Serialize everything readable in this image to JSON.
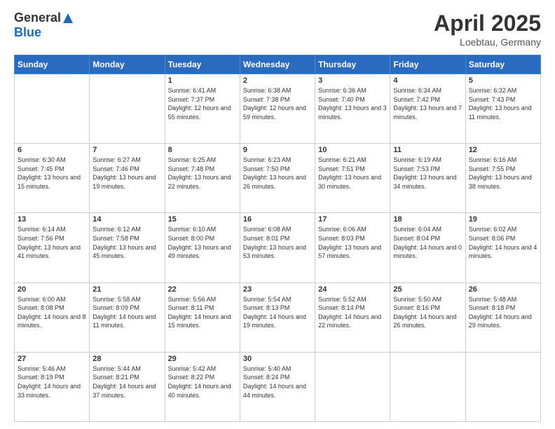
{
  "logo": {
    "general": "General",
    "blue": "Blue"
  },
  "title": "April 2025",
  "location": "Loebtau, Germany",
  "days_of_week": [
    "Sunday",
    "Monday",
    "Tuesday",
    "Wednesday",
    "Thursday",
    "Friday",
    "Saturday"
  ],
  "weeks": [
    [
      {
        "day": "",
        "sunrise": "",
        "sunset": "",
        "daylight": ""
      },
      {
        "day": "",
        "sunrise": "",
        "sunset": "",
        "daylight": ""
      },
      {
        "day": "1",
        "sunrise": "Sunrise: 6:41 AM",
        "sunset": "Sunset: 7:37 PM",
        "daylight": "Daylight: 12 hours and 55 minutes."
      },
      {
        "day": "2",
        "sunrise": "Sunrise: 6:38 AM",
        "sunset": "Sunset: 7:38 PM",
        "daylight": "Daylight: 12 hours and 59 minutes."
      },
      {
        "day": "3",
        "sunrise": "Sunrise: 6:36 AM",
        "sunset": "Sunset: 7:40 PM",
        "daylight": "Daylight: 13 hours and 3 minutes."
      },
      {
        "day": "4",
        "sunrise": "Sunrise: 6:34 AM",
        "sunset": "Sunset: 7:42 PM",
        "daylight": "Daylight: 13 hours and 7 minutes."
      },
      {
        "day": "5",
        "sunrise": "Sunrise: 6:32 AM",
        "sunset": "Sunset: 7:43 PM",
        "daylight": "Daylight: 13 hours and 11 minutes."
      }
    ],
    [
      {
        "day": "6",
        "sunrise": "Sunrise: 6:30 AM",
        "sunset": "Sunset: 7:45 PM",
        "daylight": "Daylight: 13 hours and 15 minutes."
      },
      {
        "day": "7",
        "sunrise": "Sunrise: 6:27 AM",
        "sunset": "Sunset: 7:46 PM",
        "daylight": "Daylight: 13 hours and 19 minutes."
      },
      {
        "day": "8",
        "sunrise": "Sunrise: 6:25 AM",
        "sunset": "Sunset: 7:48 PM",
        "daylight": "Daylight: 13 hours and 22 minutes."
      },
      {
        "day": "9",
        "sunrise": "Sunrise: 6:23 AM",
        "sunset": "Sunset: 7:50 PM",
        "daylight": "Daylight: 13 hours and 26 minutes."
      },
      {
        "day": "10",
        "sunrise": "Sunrise: 6:21 AM",
        "sunset": "Sunset: 7:51 PM",
        "daylight": "Daylight: 13 hours and 30 minutes."
      },
      {
        "day": "11",
        "sunrise": "Sunrise: 6:19 AM",
        "sunset": "Sunset: 7:53 PM",
        "daylight": "Daylight: 13 hours and 34 minutes."
      },
      {
        "day": "12",
        "sunrise": "Sunrise: 6:16 AM",
        "sunset": "Sunset: 7:55 PM",
        "daylight": "Daylight: 13 hours and 38 minutes."
      }
    ],
    [
      {
        "day": "13",
        "sunrise": "Sunrise: 6:14 AM",
        "sunset": "Sunset: 7:56 PM",
        "daylight": "Daylight: 13 hours and 41 minutes."
      },
      {
        "day": "14",
        "sunrise": "Sunrise: 6:12 AM",
        "sunset": "Sunset: 7:58 PM",
        "daylight": "Daylight: 13 hours and 45 minutes."
      },
      {
        "day": "15",
        "sunrise": "Sunrise: 6:10 AM",
        "sunset": "Sunset: 8:00 PM",
        "daylight": "Daylight: 13 hours and 49 minutes."
      },
      {
        "day": "16",
        "sunrise": "Sunrise: 6:08 AM",
        "sunset": "Sunset: 8:01 PM",
        "daylight": "Daylight: 13 hours and 53 minutes."
      },
      {
        "day": "17",
        "sunrise": "Sunrise: 6:06 AM",
        "sunset": "Sunset: 8:03 PM",
        "daylight": "Daylight: 13 hours and 57 minutes."
      },
      {
        "day": "18",
        "sunrise": "Sunrise: 6:04 AM",
        "sunset": "Sunset: 8:04 PM",
        "daylight": "Daylight: 14 hours and 0 minutes."
      },
      {
        "day": "19",
        "sunrise": "Sunrise: 6:02 AM",
        "sunset": "Sunset: 8:06 PM",
        "daylight": "Daylight: 14 hours and 4 minutes."
      }
    ],
    [
      {
        "day": "20",
        "sunrise": "Sunrise: 6:00 AM",
        "sunset": "Sunset: 8:08 PM",
        "daylight": "Daylight: 14 hours and 8 minutes."
      },
      {
        "day": "21",
        "sunrise": "Sunrise: 5:58 AM",
        "sunset": "Sunset: 8:09 PM",
        "daylight": "Daylight: 14 hours and 11 minutes."
      },
      {
        "day": "22",
        "sunrise": "Sunrise: 5:56 AM",
        "sunset": "Sunset: 8:11 PM",
        "daylight": "Daylight: 14 hours and 15 minutes."
      },
      {
        "day": "23",
        "sunrise": "Sunrise: 5:54 AM",
        "sunset": "Sunset: 8:13 PM",
        "daylight": "Daylight: 14 hours and 19 minutes."
      },
      {
        "day": "24",
        "sunrise": "Sunrise: 5:52 AM",
        "sunset": "Sunset: 8:14 PM",
        "daylight": "Daylight: 14 hours and 22 minutes."
      },
      {
        "day": "25",
        "sunrise": "Sunrise: 5:50 AM",
        "sunset": "Sunset: 8:16 PM",
        "daylight": "Daylight: 14 hours and 26 minutes."
      },
      {
        "day": "26",
        "sunrise": "Sunrise: 5:48 AM",
        "sunset": "Sunset: 8:18 PM",
        "daylight": "Daylight: 14 hours and 29 minutes."
      }
    ],
    [
      {
        "day": "27",
        "sunrise": "Sunrise: 5:46 AM",
        "sunset": "Sunset: 8:19 PM",
        "daylight": "Daylight: 14 hours and 33 minutes."
      },
      {
        "day": "28",
        "sunrise": "Sunrise: 5:44 AM",
        "sunset": "Sunset: 8:21 PM",
        "daylight": "Daylight: 14 hours and 37 minutes."
      },
      {
        "day": "29",
        "sunrise": "Sunrise: 5:42 AM",
        "sunset": "Sunset: 8:22 PM",
        "daylight": "Daylight: 14 hours and 40 minutes."
      },
      {
        "day": "30",
        "sunrise": "Sunrise: 5:40 AM",
        "sunset": "Sunset: 8:24 PM",
        "daylight": "Daylight: 14 hours and 44 minutes."
      },
      {
        "day": "",
        "sunrise": "",
        "sunset": "",
        "daylight": ""
      },
      {
        "day": "",
        "sunrise": "",
        "sunset": "",
        "daylight": ""
      },
      {
        "day": "",
        "sunrise": "",
        "sunset": "",
        "daylight": ""
      }
    ]
  ]
}
